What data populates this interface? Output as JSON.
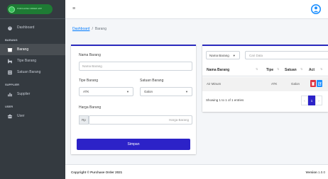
{
  "sidebar": {
    "logo_text": "PURCHASE ORDER APP",
    "items": [
      {
        "label": "Dashboard",
        "icon": "dashboard-icon",
        "active": false
      },
      {
        "header": "BARANG"
      },
      {
        "label": "Barang",
        "icon": "box-icon",
        "active": true
      },
      {
        "label": "Tipe Barang",
        "icon": "truck-icon",
        "active": false
      },
      {
        "label": "Satuan Barang",
        "icon": "table-icon",
        "active": false
      },
      {
        "header": "SUPPLIER"
      },
      {
        "label": "Supplier",
        "icon": "chart-icon",
        "active": false
      },
      {
        "header": "USER"
      },
      {
        "label": "User",
        "icon": "users-icon",
        "active": false
      }
    ]
  },
  "topbar": {
    "menu_icon": "≡",
    "user_icon": "user-circle-icon"
  },
  "breadcrumb": {
    "root": "Dashboard",
    "separator": "/",
    "current": "Barang"
  },
  "form": {
    "nama_label": "Nama Barang",
    "nama_placeholder": "Nama Barang",
    "tipe_label": "Tipe Barang",
    "tipe_value": "ATK",
    "satuan_label": "Satuan Barang",
    "satuan_value": "Galon",
    "harga_label": "Harga Barang",
    "harga_prefix": "Rp",
    "harga_placeholder": "Harga Barang",
    "save_label": "Simpan"
  },
  "table": {
    "filter_value": "Nama Barang",
    "search_placeholder": "Cari Data",
    "columns": [
      "Nama Barang",
      "Tipe",
      "Satuan",
      "Act"
    ],
    "rows": [
      {
        "nama": "Air Minum",
        "tipe": "ATK",
        "satuan": "Galon"
      }
    ],
    "info": "Showing 1 to 1 of 1 entries",
    "pagination": {
      "prev": "‹",
      "current": "1",
      "next": "›"
    }
  },
  "footer": {
    "copyright": "Copyright © Purchase Order 2021",
    "version_label": "Version",
    "version_value": "1.0.0"
  },
  "colors": {
    "sidebar_bg": "#343a40",
    "primary": "#2c22c8",
    "danger": "#dc3545",
    "info": "#1e90ff",
    "link": "#007bff"
  }
}
